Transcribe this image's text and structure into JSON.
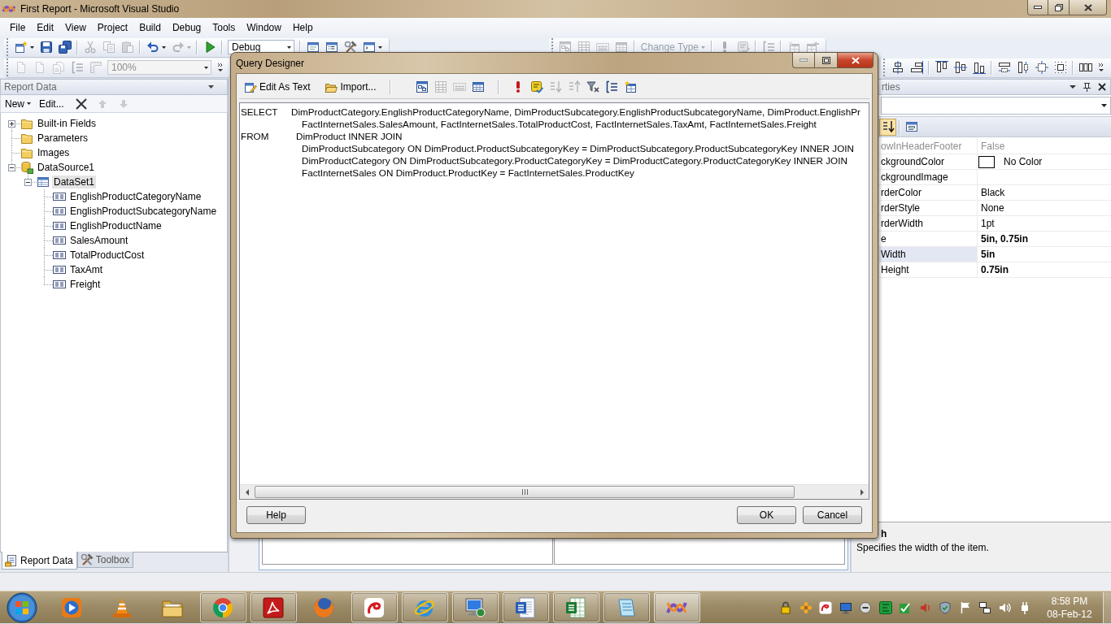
{
  "window": {
    "title": "First Report - Microsoft Visual Studio"
  },
  "menu": [
    "File",
    "Edit",
    "View",
    "Project",
    "Build",
    "Debug",
    "Tools",
    "Window",
    "Help"
  ],
  "toolbar_rows": [
    [
      [
        {
          "kind": "newproject",
          "disabled": false,
          "dropdown": true
        },
        {
          "kind": "save",
          "disabled": false
        },
        {
          "kind": "saveall",
          "disabled": false
        },
        {
          "kind": "separator"
        },
        {
          "kind": "cut",
          "disabled": true
        },
        {
          "kind": "copy",
          "disabled": true
        },
        {
          "kind": "paste",
          "disabled": true
        },
        {
          "kind": "separator"
        },
        {
          "kind": "undo",
          "disabled": false,
          "dropdown": true
        },
        {
          "kind": "redo",
          "disabled": true,
          "dropdown": true
        },
        {
          "kind": "separator"
        },
        {
          "kind": "start",
          "disabled": false
        },
        {
          "kind": "separator"
        },
        {
          "kind": "combo",
          "text": "Debug",
          "disabled": false
        },
        {
          "kind": "separator"
        },
        {
          "kind": "window",
          "disabled": false
        },
        {
          "kind": "listwindow",
          "disabled": false
        },
        {
          "kind": "tools",
          "disabled": false
        },
        {
          "kind": "console",
          "disabled": false,
          "dropdown": true
        }
      ],
      [
        {
          "kind": "diagrampane",
          "disabled": true
        },
        {
          "kind": "gridpane",
          "disabled": true
        },
        {
          "kind": "sqlpane",
          "disabled": true
        },
        {
          "kind": "resultspane",
          "disabled": true
        },
        {
          "kind": "separator"
        },
        {
          "kind": "menubutton",
          "text": "Change Type",
          "disabled": true
        },
        {
          "kind": "separator"
        },
        {
          "kind": "run",
          "disabled": true
        },
        {
          "kind": "verifysql",
          "disabled": true
        },
        {
          "kind": "separator"
        },
        {
          "kind": "groupby",
          "disabled": true
        },
        {
          "kind": "separator"
        },
        {
          "kind": "addtable",
          "disabled": true
        },
        {
          "kind": "addderived",
          "disabled": true
        }
      ]
    ],
    [
      [
        {
          "kind": "page",
          "disabled": true
        },
        {
          "kind": "page",
          "disabled": true
        },
        {
          "kind": "pagestack",
          "disabled": true
        },
        {
          "kind": "groupby",
          "disabled": true
        },
        {
          "kind": "ruler",
          "disabled": true
        },
        {
          "kind": "combo",
          "text": "100%",
          "disabled": true
        },
        {
          "kind": "overflow"
        }
      ],
      [
        {
          "kind": "aligncenter",
          "disabled": false
        },
        {
          "kind": "alignright",
          "disabled": false
        },
        {
          "kind": "separator"
        },
        {
          "kind": "aligntop",
          "disabled": false
        },
        {
          "kind": "alignmiddle",
          "disabled": false
        },
        {
          "kind": "alignbottom",
          "disabled": false
        },
        {
          "kind": "separator"
        },
        {
          "kind": "samewidth",
          "disabled": false
        },
        {
          "kind": "sameheight",
          "disabled": false
        },
        {
          "kind": "samesize",
          "disabled": false
        },
        {
          "kind": "sizegrid",
          "disabled": false
        },
        {
          "kind": "separator"
        },
        {
          "kind": "spacing",
          "disabled": false
        },
        {
          "kind": "overflow"
        }
      ]
    ]
  ],
  "report_data": {
    "title": "Report Data",
    "toolbar": [
      {
        "kind": "new",
        "text": "New",
        "dropdown": true
      },
      {
        "kind": "edit",
        "text": "Edit..."
      },
      {
        "kind": "delete",
        "disabled": false
      },
      {
        "kind": "moveup",
        "disabled": true
      },
      {
        "kind": "movedown",
        "disabled": true
      }
    ],
    "tree": [
      {
        "kind": "folder",
        "label": "Built-in Fields",
        "expanded": false,
        "selected": false
      },
      {
        "kind": "folder",
        "label": "Parameters",
        "selected": false
      },
      {
        "kind": "folder",
        "label": "Images",
        "selected": false
      },
      {
        "kind": "datasource",
        "label": "DataSource1",
        "expanded": true,
        "selected": false,
        "children": [
          {
            "kind": "dataset",
            "label": "DataSet1",
            "expanded": true,
            "selected": true,
            "children": [
              {
                "kind": "field",
                "label": "EnglishProductCategoryName",
                "selected": false
              },
              {
                "kind": "field",
                "label": "EnglishProductSubcategoryName",
                "selected": false
              },
              {
                "kind": "field",
                "label": "EnglishProductName",
                "selected": false
              },
              {
                "kind": "field",
                "label": "SalesAmount",
                "selected": false
              },
              {
                "kind": "field",
                "label": "TotalProductCost",
                "selected": false
              },
              {
                "kind": "field",
                "label": "TaxAmt",
                "selected": false
              },
              {
                "kind": "field",
                "label": "Freight",
                "selected": false
              }
            ]
          }
        ]
      }
    ],
    "tabs": [
      {
        "kind": "reportdata",
        "label": "Report Data",
        "selected": true
      },
      {
        "kind": "toolbox",
        "label": "Toolbox",
        "selected": false
      }
    ]
  },
  "properties": {
    "title": "rties",
    "toolbar": [
      {
        "kind": "sortalpha",
        "pressed": true
      },
      {
        "kind": "separator"
      },
      {
        "kind": "proppages",
        "pressed": false
      }
    ],
    "rows": [
      {
        "name": "owInHeaderFooter",
        "value": "False",
        "readonly": true,
        "modified": false,
        "selected": false
      },
      {
        "name": "ckgroundColor",
        "value": "No Color",
        "color": "#ffffff",
        "readonly": false,
        "modified": false,
        "selected": false
      },
      {
        "name": "ckgroundImage",
        "readonly": false,
        "selected": false
      },
      {
        "name": "rderColor",
        "value": "Black",
        "readonly": false,
        "modified": false,
        "selected": false
      },
      {
        "name": "rderStyle",
        "value": "None",
        "readonly": false,
        "modified": false,
        "selected": false
      },
      {
        "name": "rderWidth",
        "value": "1pt",
        "readonly": false,
        "modified": false,
        "selected": false
      },
      {
        "name": "e",
        "value": "5in, 0.75in",
        "readonly": false,
        "modified": true,
        "selected": false
      },
      {
        "name": "Width",
        "value": "5in",
        "readonly": false,
        "modified": true,
        "selected": true
      },
      {
        "name": "Height",
        "value": "0.75in",
        "readonly": false,
        "modified": true,
        "selected": false
      }
    ],
    "description": {
      "title": "h",
      "text": "Specifies the width of the item."
    }
  },
  "query_designer": {
    "title": "Query Designer",
    "toolbar": [
      {
        "kind": "edittext",
        "text": "Edit As Text"
      },
      {
        "kind": "import",
        "text": "Import..."
      },
      {
        "kind": "separator"
      },
      {
        "kind": "diagrampane",
        "disabled": false
      },
      {
        "kind": "gridpane",
        "disabled": true
      },
      {
        "kind": "sqlpane",
        "disabled": true
      },
      {
        "kind": "resultspane",
        "disabled": false
      },
      {
        "kind": "separator"
      },
      {
        "kind": "run",
        "disabled": false
      },
      {
        "kind": "verifysql",
        "disabled": false
      },
      {
        "kind": "sortasc",
        "disabled": true
      },
      {
        "kind": "sortdesc",
        "disabled": true
      },
      {
        "kind": "removefilter",
        "disabled": false
      },
      {
        "kind": "groupby",
        "disabled": false
      },
      {
        "kind": "addtable",
        "disabled": false
      }
    ],
    "sql": [
      {
        "keyword": "SELECT",
        "text": "DimProductCategory.EnglishProductCategoryName, DimProductSubcategory.EnglishProductSubcategoryName, DimProduct.EnglishPr"
      },
      {
        "text": "FactInternetSales.SalesAmount, FactInternetSales.TotalProductCost, FactInternetSales.TaxAmt, FactInternetSales.Freight"
      },
      {
        "keyword": "FROM",
        "text": "DimProduct INNER JOIN"
      },
      {
        "text": "DimProductSubcategory ON DimProduct.ProductSubcategoryKey = DimProductSubcategory.ProductSubcategoryKey INNER JOIN"
      },
      {
        "text": "DimProductCategory ON DimProductSubcategory.ProductCategoryKey = DimProductCategory.ProductCategoryKey INNER JOIN"
      },
      {
        "text": "FactInternetSales ON DimProduct.ProductKey = FactInternetSales.ProductKey"
      }
    ],
    "buttons": [
      {
        "kind": "help",
        "label": "Help"
      },
      {
        "kind": "ok",
        "label": "OK"
      },
      {
        "kind": "cancel",
        "label": "Cancel"
      }
    ]
  },
  "taskbar": {
    "apps": [
      {
        "kind": "player",
        "running": false,
        "selected": false
      },
      {
        "kind": "cone",
        "running": false,
        "selected": false
      },
      {
        "kind": "folder",
        "running": false,
        "selected": false
      },
      {
        "kind": "ring",
        "running": true,
        "selected": false
      },
      {
        "kind": "swirltile",
        "running": true,
        "selected": false
      },
      {
        "kind": "globe",
        "running": false,
        "selected": false
      },
      {
        "kind": "swirl",
        "running": true,
        "selected": false
      },
      {
        "kind": "orbit",
        "running": true,
        "selected": false
      },
      {
        "kind": "monitor",
        "running": true,
        "selected": false
      },
      {
        "kind": "doctile",
        "running": true,
        "selected": false
      },
      {
        "kind": "sheet",
        "running": true,
        "selected": false
      },
      {
        "kind": "notepad",
        "running": true,
        "selected": false
      },
      {
        "kind": "ribbon",
        "running": true,
        "selected": true
      }
    ],
    "clock": {
      "time": "8:58 PM",
      "date": "08-Feb-12"
    }
  }
}
